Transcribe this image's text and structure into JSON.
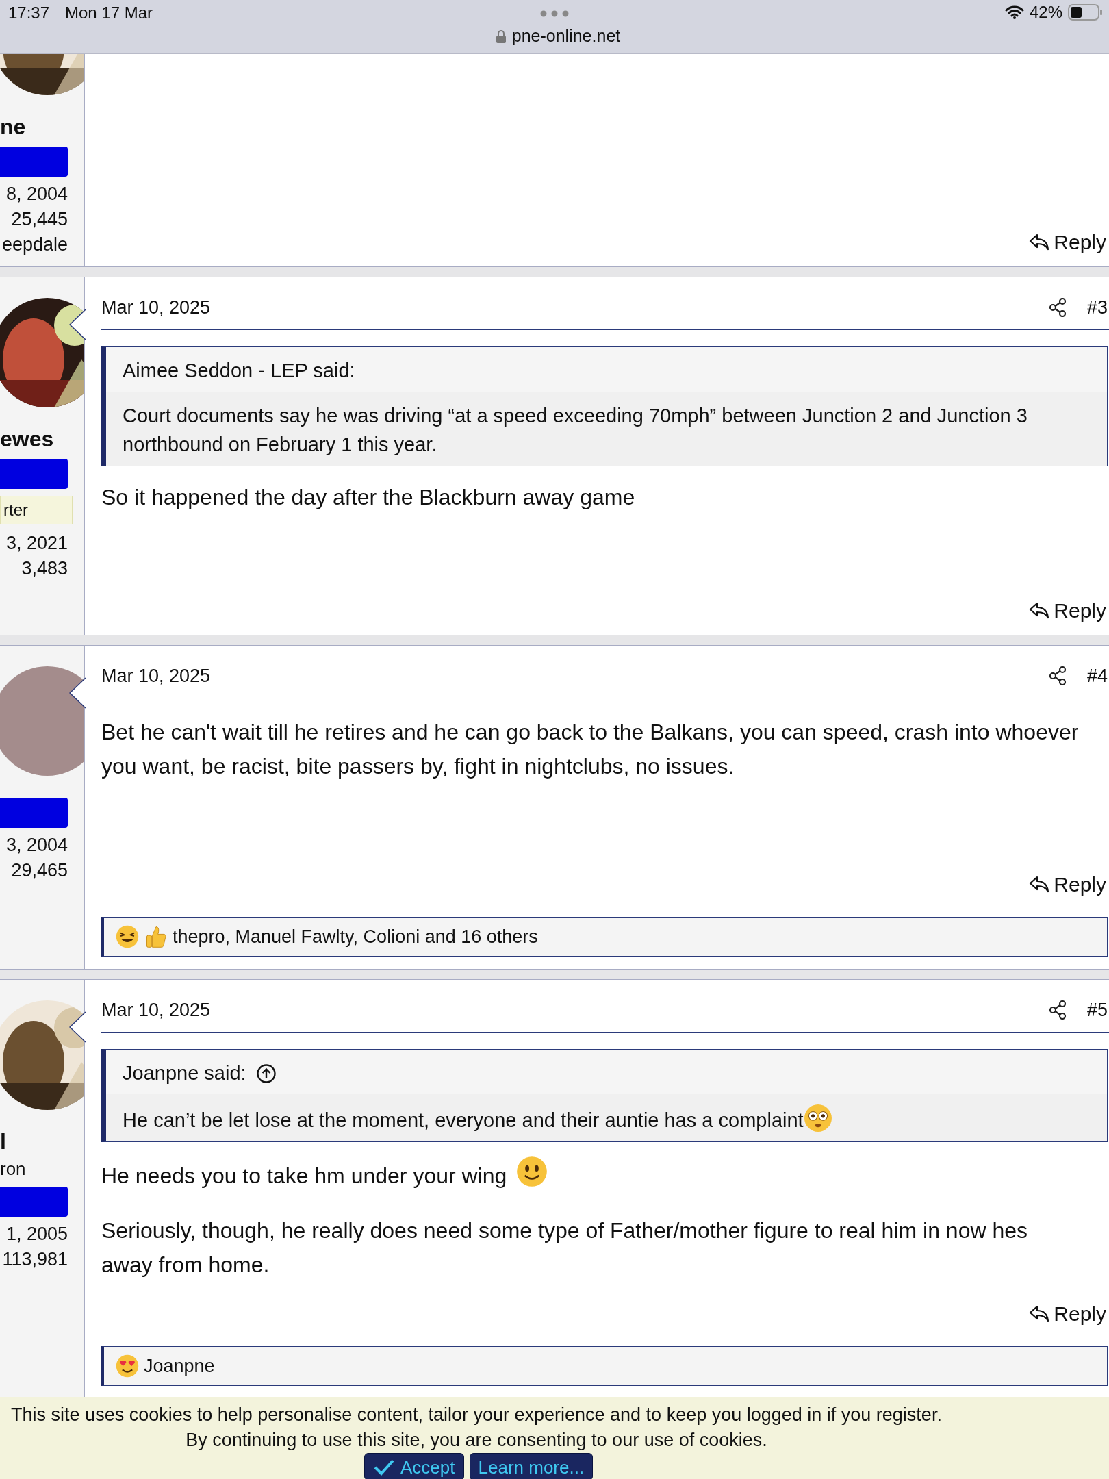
{
  "status_bar": {
    "time": "17:37",
    "date": "Mon 17 Mar",
    "url": "pne-online.net",
    "battery": "42%"
  },
  "posts": [
    {
      "user": {
        "name": "ne",
        "joined": "8, 2004",
        "messages": "25,445",
        "location": "eepdale"
      },
      "reply": "Reply"
    },
    {
      "user": {
        "name": "ewes",
        "badge": "rter",
        "joined": "3, 2021",
        "messages": "3,483"
      },
      "date": "Mar 10, 2025",
      "number": "#3",
      "quote": {
        "author": "Aimee Seddon - LEP said:",
        "jump": false,
        "text": "Court documents say he was driving “at a speed exceeding 70mph” between Junction 2 and Junction 3 northbound on February 1 this year."
      },
      "paragraphs": [
        {
          "text": "So it happened the day after the Blackburn away game"
        }
      ],
      "reply": "Reply"
    },
    {
      "user": {
        "avatar": {
          "kind": "plain",
          "color": "#a48c8c"
        },
        "joined": "3, 2004",
        "messages": "29,465"
      },
      "date": "Mar 10, 2025",
      "number": "#4",
      "paragraphs": [
        {
          "text": "Bet he can't wait till he retires and he can go back to the Balkans, you can speed, crash into whoever you want, be racist, bite passers by, fight in nightclubs, no issues."
        }
      ],
      "reply": "Reply",
      "reactions": {
        "icons": [
          {
            "kind": "laughing"
          },
          {
            "kind": "thumbs-up"
          }
        ],
        "text": "thepro, Manuel Fawlty, Colioni and 16 others"
      }
    },
    {
      "user": {
        "name": "l",
        "title": "ron",
        "joined": "1, 2005",
        "messages": "113,981"
      },
      "date": "Mar 10, 2025",
      "number": "#5",
      "quote": {
        "author": "Joanpne said:",
        "jump": true,
        "text": "He can’t be let lose at the moment, everyone and their auntie has a complaint",
        "emoji": {
          "kind": "flushed"
        }
      },
      "paragraphs": [
        {
          "text": "He needs you to take hm under your wing",
          "emoji": {
            "kind": "smiley"
          }
        },
        {
          "text": "Seriously, though, he really does need some type of Father/mother figure to real him in now hes away from home."
        }
      ],
      "reply": "Reply",
      "reactions": {
        "icons": [
          {
            "kind": "heart-eyes"
          }
        ],
        "text": "Joanpne"
      }
    }
  ],
  "cookie_notice": {
    "lines": [
      "This site uses cookies to help personalise content, tailor your experience and to keep you logged in if you register.",
      "By continuing to use this site, you are consenting to our use of cookies."
    ],
    "buttons": [
      {
        "kind": "accept",
        "label": "Accept"
      },
      {
        "kind": "link",
        "label": "Learn more..."
      }
    ]
  }
}
